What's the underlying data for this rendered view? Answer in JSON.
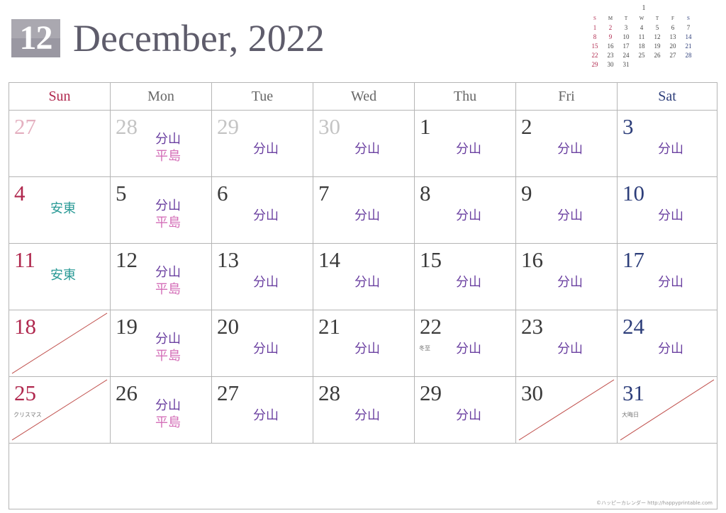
{
  "header": {
    "month_number": "12",
    "title": "December, 2022"
  },
  "mini_calendar": {
    "month": "1",
    "dow": [
      "S",
      "M",
      "T",
      "W",
      "T",
      "F",
      "S"
    ],
    "weeks": [
      [
        {
          "d": "1",
          "c": "sun"
        },
        {
          "d": "2",
          "c": "sun"
        },
        {
          "d": "3",
          "c": "wk"
        },
        {
          "d": "4",
          "c": "wk"
        },
        {
          "d": "5",
          "c": "wk"
        },
        {
          "d": "6",
          "c": "wk"
        },
        {
          "d": "7",
          "c": "wk"
        }
      ],
      [
        {
          "d": "8",
          "c": "sun"
        },
        {
          "d": "9",
          "c": "sun"
        },
        {
          "d": "10",
          "c": "wk"
        },
        {
          "d": "11",
          "c": "wk"
        },
        {
          "d": "12",
          "c": "wk"
        },
        {
          "d": "13",
          "c": "wk"
        },
        {
          "d": "14",
          "c": "sat"
        }
      ],
      [
        {
          "d": "15",
          "c": "sun"
        },
        {
          "d": "16",
          "c": "wk"
        },
        {
          "d": "17",
          "c": "wk"
        },
        {
          "d": "18",
          "c": "wk"
        },
        {
          "d": "19",
          "c": "wk"
        },
        {
          "d": "20",
          "c": "wk"
        },
        {
          "d": "21",
          "c": "sat"
        }
      ],
      [
        {
          "d": "22",
          "c": "sun"
        },
        {
          "d": "23",
          "c": "wk"
        },
        {
          "d": "24",
          "c": "wk"
        },
        {
          "d": "25",
          "c": "wk"
        },
        {
          "d": "26",
          "c": "wk"
        },
        {
          "d": "27",
          "c": "wk"
        },
        {
          "d": "28",
          "c": "sat"
        }
      ],
      [
        {
          "d": "29",
          "c": "sun"
        },
        {
          "d": "30",
          "c": "wk"
        },
        {
          "d": "31",
          "c": "wk"
        },
        {
          "d": "",
          "c": "wk"
        },
        {
          "d": "",
          "c": "wk"
        },
        {
          "d": "",
          "c": "wk"
        },
        {
          "d": "",
          "c": "wk"
        }
      ]
    ]
  },
  "weekdays": [
    {
      "label": "Sun",
      "type": "sun"
    },
    {
      "label": "Mon",
      "type": "wk"
    },
    {
      "label": "Tue",
      "type": "wk"
    },
    {
      "label": "Wed",
      "type": "wk"
    },
    {
      "label": "Thu",
      "type": "wk"
    },
    {
      "label": "Fri",
      "type": "wk"
    },
    {
      "label": "Sat",
      "type": "sat"
    }
  ],
  "colors": {
    "sunday": "#b0284e",
    "saturday": "#2d3e7a",
    "weekday": "#3a3a3a",
    "event_bunzan": "#6a3fa0",
    "event_hirashima": "#d46fb8",
    "event_anto": "#2a9a96",
    "slash": "#c0504d"
  },
  "weeks": [
    [
      {
        "day": "27",
        "other": true,
        "events": []
      },
      {
        "day": "28",
        "other": true,
        "events": [
          "分山",
          "平島"
        ]
      },
      {
        "day": "29",
        "other": true,
        "events": [
          "分山"
        ]
      },
      {
        "day": "30",
        "other": true,
        "events": [
          "分山"
        ]
      },
      {
        "day": "1",
        "events": [
          "分山"
        ]
      },
      {
        "day": "2",
        "events": [
          "分山"
        ]
      },
      {
        "day": "3",
        "events": [
          "分山"
        ]
      }
    ],
    [
      {
        "day": "4",
        "events": [
          "安東"
        ]
      },
      {
        "day": "5",
        "events": [
          "分山",
          "平島"
        ]
      },
      {
        "day": "6",
        "events": [
          "分山"
        ]
      },
      {
        "day": "7",
        "events": [
          "分山"
        ]
      },
      {
        "day": "8",
        "events": [
          "分山"
        ]
      },
      {
        "day": "9",
        "events": [
          "分山"
        ]
      },
      {
        "day": "10",
        "events": [
          "分山"
        ]
      }
    ],
    [
      {
        "day": "11",
        "events": [
          "安東"
        ]
      },
      {
        "day": "12",
        "events": [
          "分山",
          "平島"
        ]
      },
      {
        "day": "13",
        "events": [
          "分山"
        ]
      },
      {
        "day": "14",
        "events": [
          "分山"
        ]
      },
      {
        "day": "15",
        "events": [
          "分山"
        ]
      },
      {
        "day": "16",
        "events": [
          "分山"
        ]
      },
      {
        "day": "17",
        "events": [
          "分山"
        ]
      }
    ],
    [
      {
        "day": "18",
        "events": [],
        "slashed": true
      },
      {
        "day": "19",
        "events": [
          "分山",
          "平島"
        ]
      },
      {
        "day": "20",
        "events": [
          "分山"
        ]
      },
      {
        "day": "21",
        "events": [
          "分山"
        ]
      },
      {
        "day": "22",
        "note": "冬至",
        "events": [
          "分山"
        ]
      },
      {
        "day": "23",
        "events": [
          "分山"
        ]
      },
      {
        "day": "24",
        "events": [
          "分山"
        ]
      }
    ],
    [
      {
        "day": "25",
        "note": "クリスマス",
        "events": [],
        "slashed": true
      },
      {
        "day": "26",
        "events": [
          "分山",
          "平島"
        ]
      },
      {
        "day": "27",
        "events": [
          "分山"
        ]
      },
      {
        "day": "28",
        "events": [
          "分山"
        ]
      },
      {
        "day": "29",
        "events": [
          "分山"
        ]
      },
      {
        "day": "30",
        "events": [],
        "slashed": true
      },
      {
        "day": "31",
        "note": "大晦日",
        "events": [],
        "slashed": true
      }
    ]
  ],
  "footer": "©ハッピーカレンダー  http://happyprintable.com"
}
